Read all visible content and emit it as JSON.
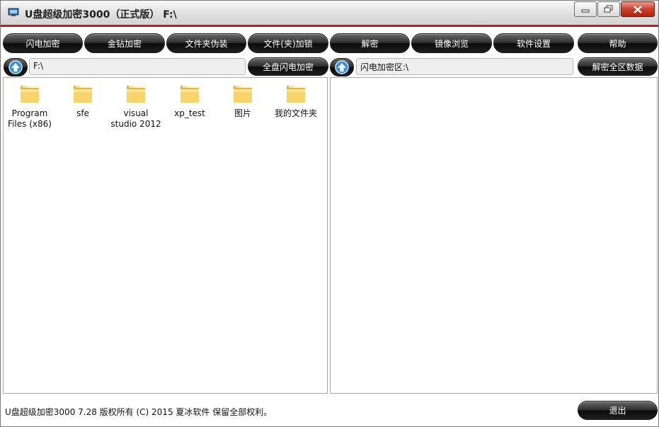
{
  "window": {
    "title": "U盘超级加密3000（正式版） F:\\"
  },
  "toolbar": {
    "buttons": [
      {
        "label": "闪电加密"
      },
      {
        "label": "金钻加密"
      },
      {
        "label": "文件夹伪装"
      },
      {
        "label": "文件(夹)加锁"
      },
      {
        "label": "解密"
      },
      {
        "label": "镜像浏览"
      },
      {
        "label": "软件设置"
      },
      {
        "label": "帮助"
      }
    ]
  },
  "left_panel": {
    "path": "F:\\",
    "action_button": "全盘闪电加密",
    "items": [
      {
        "name": "Program Files (x86)",
        "icon": "folder-icon"
      },
      {
        "name": "sfe",
        "icon": "folder-icon"
      },
      {
        "name": "visual studio 2012",
        "icon": "folder-icon"
      },
      {
        "name": "xp_test",
        "icon": "folder-icon"
      },
      {
        "name": "图片",
        "icon": "folder-icon"
      },
      {
        "name": "我的文件夹",
        "icon": "folder-icon"
      }
    ]
  },
  "right_panel": {
    "path": "闪电加密区:\\",
    "action_button": "解密全区数据"
  },
  "status": {
    "text": "U盘超级加密3000  7.28 版权所有 (C) 2015 夏冰软件 保留全部权利。"
  },
  "footer": {
    "exit_button": "退出"
  },
  "colors": {
    "accent_line": "#d0161d",
    "button_bg": "#1f1f1f",
    "button_text": "#ffffff",
    "folder": "#f2c64f"
  }
}
